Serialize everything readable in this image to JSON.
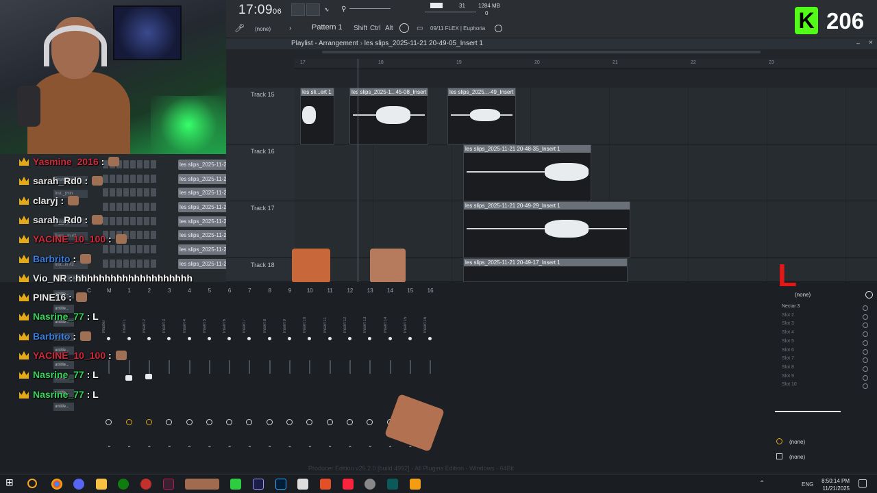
{
  "toolbar": {
    "time": "17:09",
    "time_sub": "06",
    "cpu_value": "31",
    "mem_value": "1284 MB",
    "mem_sub": "0",
    "pattern": "Pattern 1",
    "none_label": "(none)",
    "shift": "Shift",
    "ctrl": "Ctrl",
    "alt": "Alt",
    "plugin_info": "09/11 FLEX | Euphoria"
  },
  "badge": {
    "letter": "K",
    "count": "206"
  },
  "playlist": {
    "title": "Playlist - Arrangement",
    "breadcrumb": "les slips_2025-11-21 20-49-05_Insert 1",
    "ruler": [
      "17",
      "18",
      "19",
      "20",
      "21",
      "22",
      "23"
    ],
    "tracks": [
      {
        "name": "Track 15",
        "clips": [
          "les sli...ert 1",
          "les slips_2025-1...45-08_Insert 1",
          "les slips_2025...-49_Insert 1"
        ]
      },
      {
        "name": "Track 16",
        "clips": [
          "les slips_2025-11-21 20-48-35_Insert 1"
        ]
      },
      {
        "name": "Track 17",
        "clips": [
          "les slips_2025-11-21 20-49-29_Insert 1"
        ]
      },
      {
        "name": "Track 18",
        "clips": [
          "les slips_2025-11-21 20-49-17_Insert 1"
        ]
      }
    ]
  },
  "rack": {
    "rows": [
      {
        "name": "Drum_(min",
        "clip": "les slips_2025-11-21 20-"
      },
      {
        "name": "Inst._(min",
        "clip": "les slips_2025-11-21 20-"
      },
      {
        "name": "",
        "clip": "les slips_2025-11-21 20-"
      },
      {
        "name": "Vocal_(min",
        "clip": "les slips_2025-11-21 20-"
      },
      {
        "name": "Bass...in #2",
        "clip": "les slips_2025-11-21 20-"
      },
      {
        "name": "",
        "clip": "les slips_2025-11-21 20-"
      },
      {
        "name": "Inst...in #2",
        "clip": "les slips_2025-11-21 20-"
      },
      {
        "name": "Other...in #2",
        "clip": "les slips_2025-11-21 20-"
      }
    ]
  },
  "chat": [
    {
      "user": "Yasmine_2016",
      "color": "#d02a3a",
      "msg": ""
    },
    {
      "user": "sarah_Rd0",
      "color": "#e6e6e6",
      "msg": ""
    },
    {
      "user": "claryj",
      "color": "#e6e6e6",
      "msg": ""
    },
    {
      "user": "sarah_Rd0",
      "color": "#e6e6e6",
      "msg": ""
    },
    {
      "user": "YACINE_10_100",
      "color": "#d02a3a",
      "msg": ""
    },
    {
      "user": "Barbrito",
      "color": "#3a7fe0",
      "msg": ""
    },
    {
      "user": "Vio_NR",
      "color": "#e6e6e6",
      "msg": "hhhhhhhhhhhhhhhhhhhh"
    },
    {
      "user": "PINE16",
      "color": "#e6e6e6",
      "msg": ""
    },
    {
      "user": "Nasrine_77",
      "color": "#35d35a",
      "msg": "L"
    },
    {
      "user": "Barbrito",
      "color": "#3a7fe0",
      "msg": ""
    },
    {
      "user": "YACINE_10_100",
      "color": "#d02a3a",
      "msg": ""
    },
    {
      "user": "Nasrine_77",
      "color": "#35d35a",
      "msg": "L"
    },
    {
      "user": "Nasrine_77",
      "color": "#35d35a",
      "msg": "L"
    }
  ],
  "mixer": {
    "numbers": [
      "C",
      "M",
      "1",
      "2",
      "3",
      "4",
      "5",
      "6",
      "7",
      "8",
      "9",
      "10",
      "11",
      "12",
      "13",
      "14",
      "15",
      "16"
    ],
    "labels": [
      "",
      "Master",
      "Insert 1",
      "Insert 2",
      "Insert 3",
      "Insert 4",
      "Insert 5",
      "Insert 6",
      "Insert 7",
      "Insert 8",
      "Insert 9",
      "Insert 10",
      "Insert 11",
      "Insert 12",
      "Insert 13",
      "Insert 14",
      "Insert 15",
      "Insert 16"
    ],
    "left_labels": [
      "untitle...",
      "untitle...",
      "untitle...",
      "untitle...",
      "untitle...",
      "untitle...",
      "untitle...",
      "untitle...",
      "untitle..."
    ]
  },
  "fx": {
    "header": "(none)",
    "slots": [
      "Nectar 3",
      "Slot 2",
      "Slot 3",
      "Slot 4",
      "Slot 5",
      "Slot 6",
      "Slot 7",
      "Slot 8",
      "Slot 9",
      "Slot 10"
    ],
    "bottom1": "(none)",
    "bottom2": "(none)"
  },
  "overlay_l": "L",
  "watermark": "Producer Edition v25.2.0 [build 4992] - All Plugins Edition - Windows - 64Bit",
  "taskbar": {
    "lang": "ENG",
    "clock_time": "8:50:14 PM",
    "clock_date": "11/21/2025"
  }
}
